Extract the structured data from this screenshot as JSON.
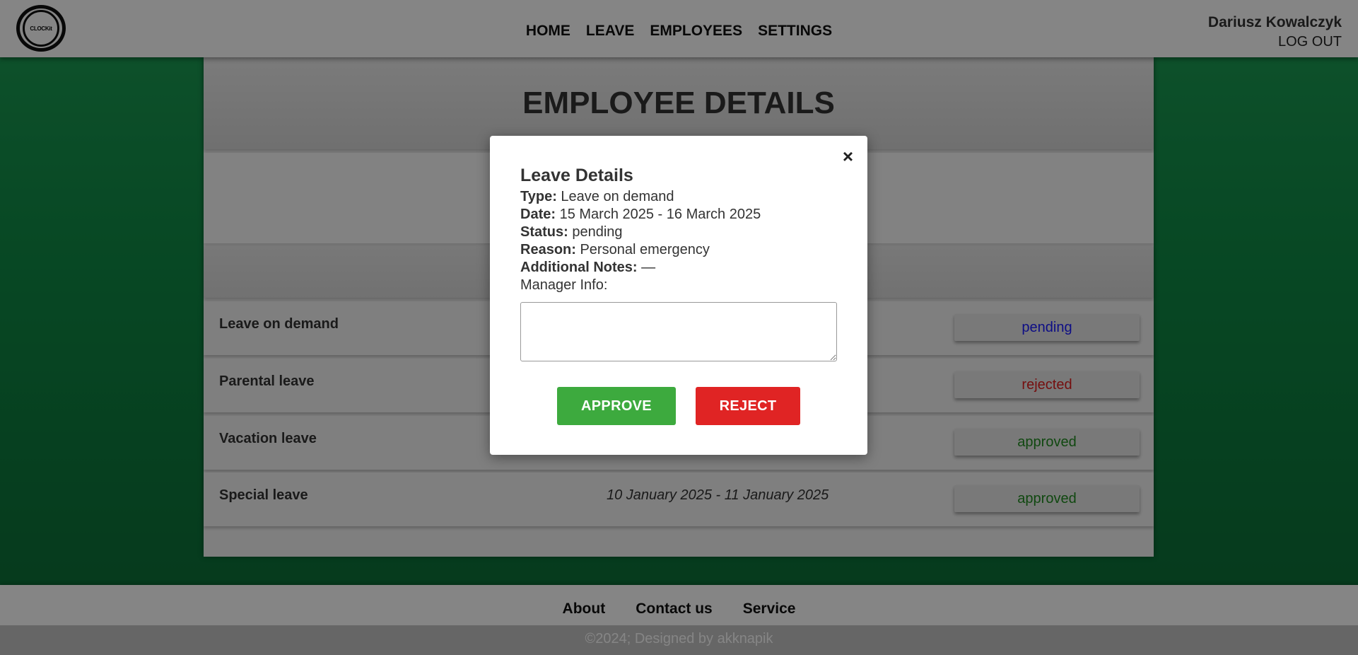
{
  "header": {
    "logo_text": "CLOCKit",
    "nav": [
      "HOME",
      "LEAVE",
      "EMPLOYEES",
      "SETTINGS"
    ],
    "user_name": "Dariusz Kowalczyk",
    "logout": "LOG OUT"
  },
  "main": {
    "title": "EMPLOYEE DETAILS",
    "leaves": [
      {
        "type": "Leave on demand",
        "date": "",
        "status": "pending",
        "status_color": "#1a1aff"
      },
      {
        "type": "Parental leave",
        "date": "",
        "status": "rejected",
        "status_color": "#e01b1b"
      },
      {
        "type": "Vacation leave",
        "date": "",
        "status": "approved",
        "status_color": "#1f8a1f"
      },
      {
        "type": "Special leave",
        "date": "10 January 2025 - 11 January 2025",
        "status": "approved",
        "status_color": "#1f8a1f"
      }
    ]
  },
  "modal": {
    "close": "×",
    "title": "Leave Details",
    "type_label": "Type:",
    "type_value": "Leave on demand",
    "date_label": "Date:",
    "date_value": "15 March 2025 - 16 March 2025",
    "status_label": "Status:",
    "status_value": "pending",
    "reason_label": "Reason:",
    "reason_value": "Personal emergency",
    "notes_label": "Additional Notes:",
    "notes_value": "—",
    "manager_label": "Manager Info:",
    "manager_value": "",
    "approve": "APPROVE",
    "reject": "REJECT"
  },
  "footer": {
    "links": [
      "About",
      "Contact us",
      "Service"
    ],
    "copyright": "©2024; Designed by akknapik"
  },
  "colors": {
    "approve": "#3daa3e",
    "reject": "#e02424",
    "background_green": "#1d9e55"
  }
}
